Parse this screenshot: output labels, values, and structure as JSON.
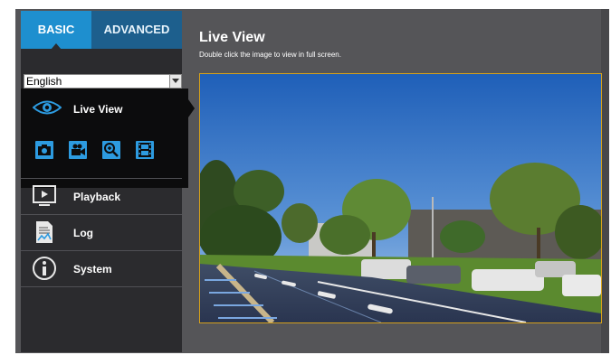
{
  "tabs": {
    "basic": "BASIC",
    "advanced": "ADVANCED"
  },
  "language": {
    "selected": "English"
  },
  "sidebar": {
    "live_view": "Live View",
    "tools": [
      "snapshot-icon",
      "record-icon",
      "zoom-icon",
      "film-icon"
    ],
    "items": [
      {
        "label": "Playback",
        "icon": "playback-icon"
      },
      {
        "label": "Log",
        "icon": "log-icon"
      },
      {
        "label": "System",
        "icon": "info-icon"
      }
    ]
  },
  "main": {
    "title": "Live View",
    "subtitle": "Double click the image to view in full screen."
  },
  "colors": {
    "accent": "#1e8fcf",
    "tab_inactive": "#1d5f8d",
    "viewport_border": "#d6a11a",
    "sidebar": "#2b2b2e"
  }
}
